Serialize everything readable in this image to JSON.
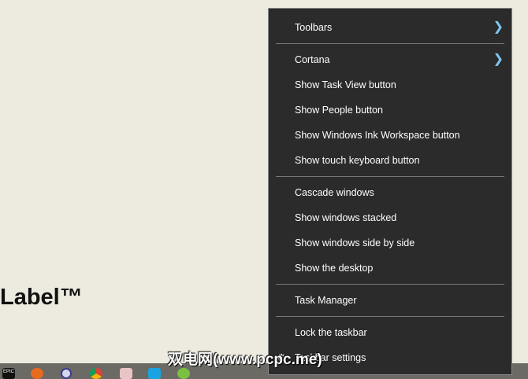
{
  "background": {
    "label_text": "Label™"
  },
  "menu": {
    "items": [
      {
        "label": "Toolbars",
        "submenu": true
      },
      {
        "label": "Cortana",
        "submenu": true
      },
      {
        "label": "Show Task View button"
      },
      {
        "label": "Show People button"
      },
      {
        "label": "Show Windows Ink Workspace button"
      },
      {
        "label": "Show touch keyboard button"
      },
      {
        "label": "Cascade windows"
      },
      {
        "label": "Show windows stacked"
      },
      {
        "label": "Show windows side by side"
      },
      {
        "label": "Show the desktop"
      },
      {
        "label": "Task Manager"
      },
      {
        "label": "Lock the taskbar"
      },
      {
        "label": "Taskbar settings"
      }
    ]
  },
  "taskbar": {
    "icons": [
      "epic-games-icon",
      "firefox-icon",
      "settings-icon",
      "chrome-icon",
      "popcorn-icon",
      "c-app-icon",
      "clover-icon"
    ],
    "epic_text": "EPIC"
  },
  "watermark": "双电网(www.pcpc.me)"
}
